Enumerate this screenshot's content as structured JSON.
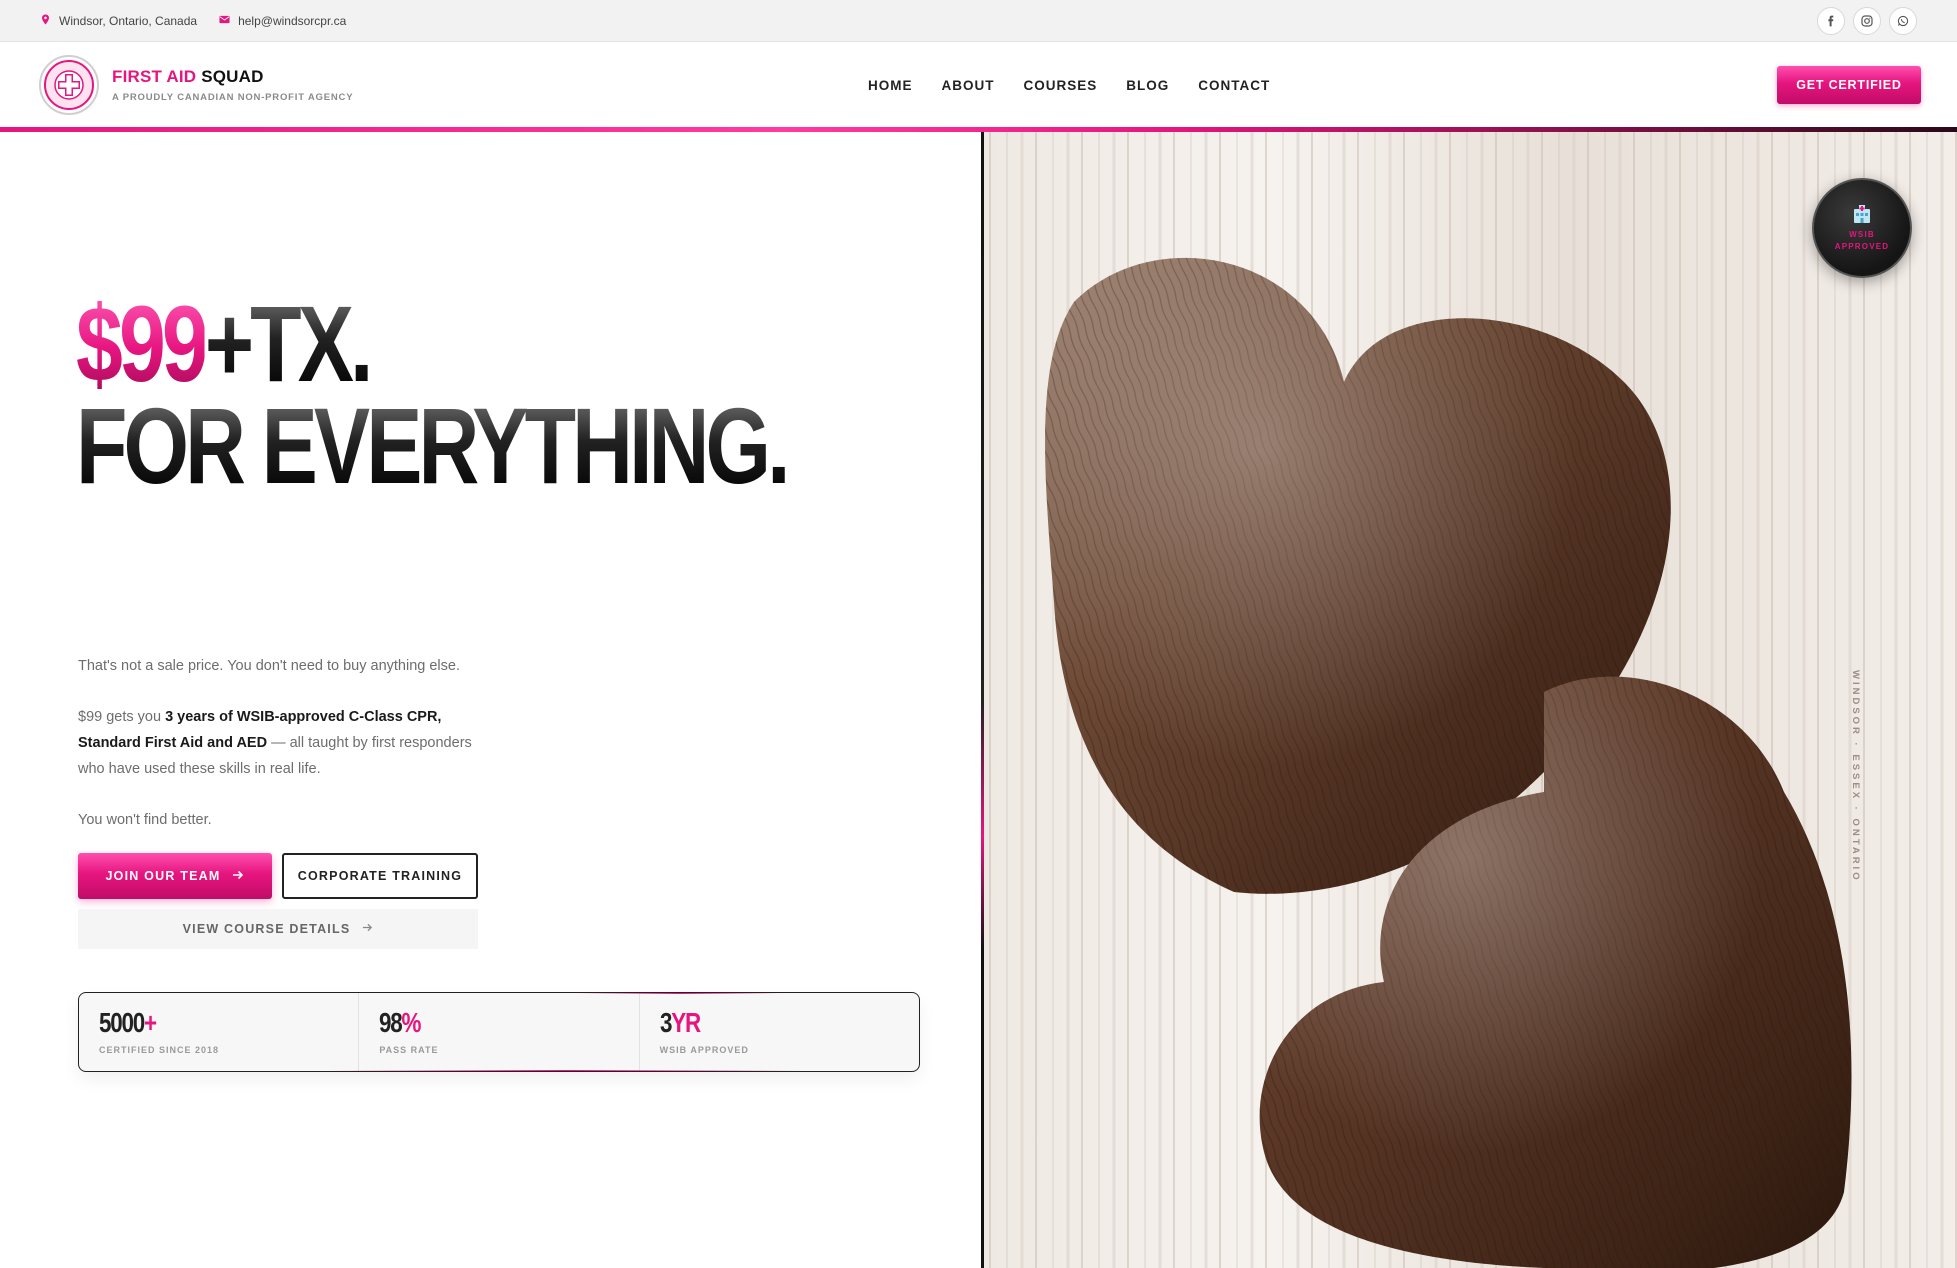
{
  "topbar": {
    "location": "Windsor, Ontario, Canada",
    "email": "help@windsorcpr.ca",
    "social": [
      "facebook-icon",
      "instagram-icon",
      "whatsapp-icon"
    ]
  },
  "brand": {
    "name_accent": "FIRST AID",
    "name_rest": " SQUAD",
    "tagline": "A PROUDLY CANADIAN NON-PROFIT AGENCY",
    "logo_text": "FIRST AID SQUAD"
  },
  "nav": {
    "items": [
      "HOME",
      "ABOUT",
      "COURSES",
      "BLOG",
      "CONTACT"
    ],
    "cta": "GET CERTIFIED"
  },
  "hero": {
    "price": "$99",
    "price_suffix": "+TX.",
    "line2": "FOR EVERYTHING.",
    "para1": "That's not a sale price. You don't need to buy anything else.",
    "para2_pre": "$99 gets you ",
    "para2_bold": "3 years of WSIB-approved C-Class CPR, Standard First Aid and AED",
    "para2_post": " — all taught by first responders who have used these skills in real life.",
    "para3": "You won't find better.",
    "btn_primary": "JOIN OUR TEAM",
    "btn_outline": "CORPORATE TRAINING",
    "btn_ghost": "VIEW COURSE DETAILS"
  },
  "stats": [
    {
      "value": "5000",
      "accent": "+",
      "label": "CERTIFIED SINCE 2018"
    },
    {
      "value": "98",
      "accent": "%",
      "label": "PASS RATE"
    },
    {
      "value": "3",
      "accent": "YR",
      "label": "WSIB APPROVED"
    }
  ],
  "badge": {
    "line1": "WSIB",
    "line2": "APPROVED"
  },
  "side_caption": "WINDSOR · ESSEX · ONTARIO",
  "colors": {
    "accent": "#e6157f",
    "dark": "#111111",
    "muted": "#6d6d6d"
  }
}
